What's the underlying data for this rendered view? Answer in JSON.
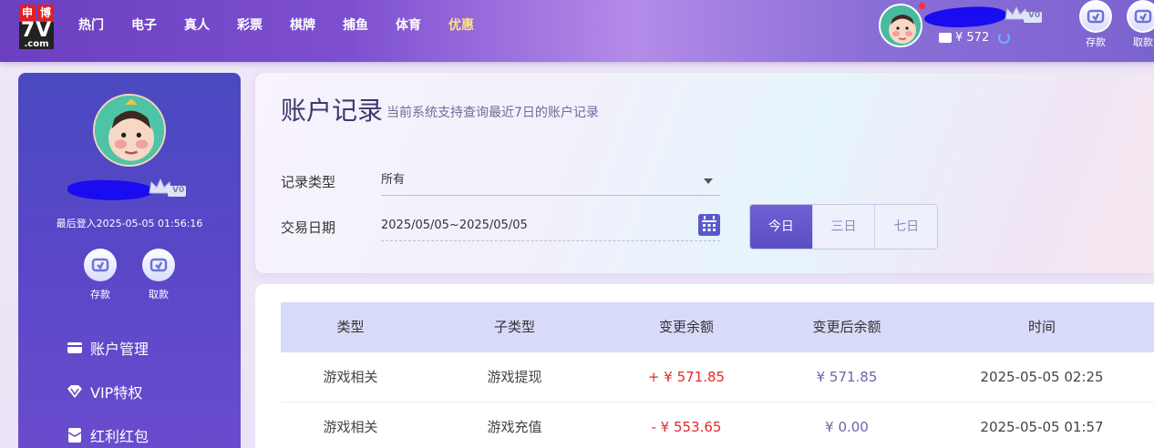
{
  "logo": {
    "cn1": "申",
    "cn2": "博",
    "big": "7V",
    "domain": ".com"
  },
  "nav": [
    {
      "label": "热门"
    },
    {
      "label": "电子"
    },
    {
      "label": "真人"
    },
    {
      "label": "彩票"
    },
    {
      "label": "棋牌"
    },
    {
      "label": "捕鱼"
    },
    {
      "label": "体育"
    },
    {
      "label": "优惠"
    }
  ],
  "header": {
    "vip_level": "V0",
    "balance": "¥ 572",
    "deposit_label": "存款",
    "withdraw_label": "取款"
  },
  "sidebar": {
    "vip_level": "V0",
    "last_login": "最后登入2025-05-05 01:56:16",
    "deposit_label": "存款",
    "withdraw_label": "取款",
    "menu": [
      {
        "label": "账户管理",
        "icon": "card-icon"
      },
      {
        "label": "VIP特权",
        "icon": "diamond-icon"
      },
      {
        "label": "红利红包",
        "icon": "envelope-icon"
      }
    ]
  },
  "filter": {
    "title": "账户记录",
    "subtitle": "当前系统支持查询最近7日的账户记录",
    "type_label": "记录类型",
    "type_value": "所有",
    "date_label": "交易日期",
    "date_value": "2025/05/05~2025/05/05",
    "ranges": [
      {
        "label": "今日",
        "active": true
      },
      {
        "label": "三日",
        "active": false
      },
      {
        "label": "七日",
        "active": false
      }
    ]
  },
  "table": {
    "columns": [
      "类型",
      "子类型",
      "变更余额",
      "变更后余额",
      "时间"
    ],
    "rows": [
      [
        "游戏相关",
        "游戏提现",
        "+ ¥ 571.85",
        "¥ 571.85",
        "2025-05-05 02:25"
      ],
      [
        "游戏相关",
        "游戏充值",
        "- ¥ 553.65",
        "¥ 0.00",
        "2025-05-05 01:57"
      ]
    ]
  },
  "colors": {
    "accent": "#5b4fc4",
    "topbar": "#7d4fd0",
    "amount": "#e12a2a",
    "hot_nav": "#ffe28a"
  }
}
